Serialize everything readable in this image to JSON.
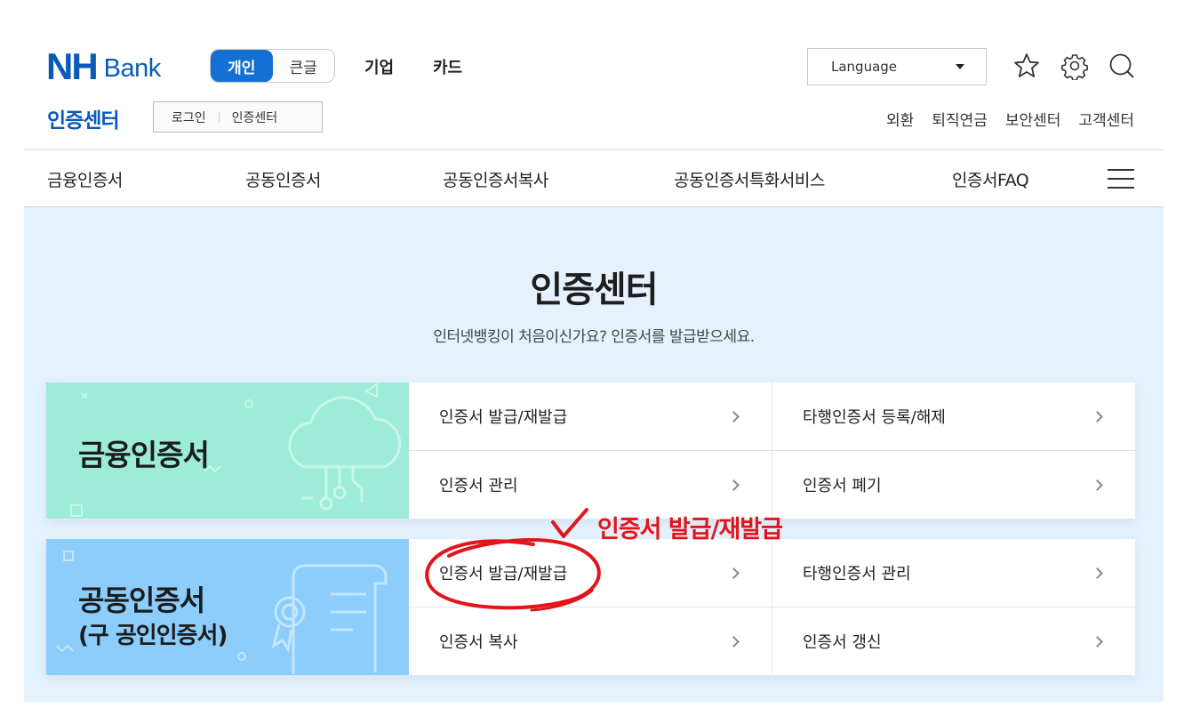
{
  "header": {
    "logo_nh": "NH",
    "logo_bank": "Bank",
    "toggle": {
      "active": "개인",
      "inactive": "큰글"
    },
    "top_links": [
      "기업",
      "카드"
    ],
    "language": "Language",
    "icons": [
      "star-icon",
      "gear-icon",
      "search-icon"
    ],
    "section_title": "인증센터",
    "sub_box": [
      "로그인",
      "인증센터"
    ],
    "util_links": [
      "외환",
      "퇴직연금",
      "보안센터",
      "고객센터"
    ]
  },
  "gnb": {
    "items": [
      "금융인증서",
      "공동인증서",
      "공동인증서복사",
      "공동인증서특화서비스",
      "인증서FAQ"
    ]
  },
  "main": {
    "title": "인증센터",
    "subtitle": "인터넷뱅킹이 처음이신가요? 인증서를 발급받으세요.",
    "cards": [
      {
        "title": "금융인증서",
        "title2": "",
        "items": [
          "인증서 발급/재발급",
          "타행인증서 등록/해제",
          "인증서 관리",
          "인증서 폐기"
        ]
      },
      {
        "title": "공동인증서",
        "title2": "(구 공인인증서)",
        "items": [
          "인증서 발급/재발급",
          "타행인증서 관리",
          "인증서 복사",
          "인증서 갱신"
        ]
      }
    ]
  },
  "annotation": {
    "text": "인증서 발급/재발급",
    "color": "#e3141c"
  },
  "colors": {
    "brand": "#0a5bb8",
    "toggle_active": "#1470d4",
    "content_bg": "#e5f2fd",
    "card1_bg": "#9decd8",
    "card2_bg": "#8ccdfb"
  }
}
